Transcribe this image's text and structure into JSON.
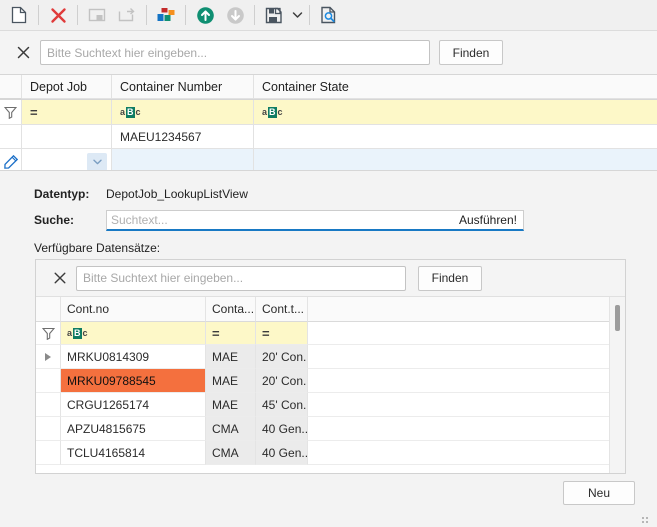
{
  "toolbar": {
    "buttons": [
      {
        "name": "new-document-icon",
        "title": "Neu"
      },
      {
        "name": "delete-icon",
        "title": "Löschen"
      },
      {
        "name": "restore-window-icon",
        "title": "Wiederherstellen"
      },
      {
        "name": "open-external-icon",
        "title": "Öffnen"
      },
      {
        "name": "layout-blocks-icon",
        "title": "Layout"
      },
      {
        "name": "upload-arrow-up-icon",
        "title": "Hochladen"
      },
      {
        "name": "download-arrow-down-icon",
        "title": "Herunterladen"
      },
      {
        "name": "save-icon",
        "title": "Speichern"
      },
      {
        "name": "chevron-down-icon",
        "title": "Mehr"
      },
      {
        "name": "document-search-icon",
        "title": "Suchen"
      }
    ]
  },
  "top_search": {
    "close_label": "✕",
    "placeholder": "Bitte Suchtext hier eingeben...",
    "value": "",
    "find_label": "Finden"
  },
  "main_grid": {
    "columns": [
      "Depot Job",
      "Container Number",
      "Container State"
    ],
    "filter_row": {
      "depot_job": "=",
      "container_number": "aBc",
      "container_state": "aBc"
    },
    "rows": [
      {
        "depot_job": "",
        "container_number": "MAEU1234567",
        "container_state": ""
      }
    ],
    "edit_row": {
      "depot_job": "",
      "container_number": "",
      "container_state": ""
    }
  },
  "detail": {
    "datentyp_label": "Datentyp:",
    "datentyp_value": "DepotJob_LookupListView",
    "suche_label": "Suche:",
    "suche_placeholder": "Suchtext...",
    "suche_value": "",
    "ausfuehren_label": "Ausführen!",
    "verfuegbar_label": "Verfügbare Datensätze:",
    "inner_search": {
      "close_label": "✕",
      "placeholder": "Bitte Suchtext hier eingeben...",
      "value": "",
      "find_label": "Finden"
    },
    "inner_grid": {
      "columns": [
        "Cont.no",
        "Conta...",
        "Cont.t...",
        ""
      ],
      "filter_row": {
        "cont_no": "aBc",
        "conta": "=",
        "cont_t": "="
      },
      "rows": [
        {
          "cont_no": "MRKU0814309",
          "conta": "MAE",
          "cont_t": "20' Con...",
          "expandable": true,
          "selected": false
        },
        {
          "cont_no": "MRKU09788545",
          "conta": "MAE",
          "cont_t": "20' Con...",
          "expandable": false,
          "selected": true
        },
        {
          "cont_no": "CRGU1265174",
          "conta": "MAE",
          "cont_t": "45' Con...",
          "expandable": false,
          "selected": false
        },
        {
          "cont_no": "APZU4815675",
          "conta": "CMA",
          "cont_t": "40 Gen...",
          "expandable": false,
          "selected": false
        },
        {
          "cont_no": "TCLU4165814",
          "conta": "CMA",
          "cont_t": "40 Gen...",
          "expandable": false,
          "selected": false
        }
      ]
    },
    "neu_label": "Neu"
  },
  "colors": {
    "filter_yellow": "#fdf8c8",
    "selection_orange": "#f4703e",
    "accent_blue": "#1879c4",
    "abc_badge_green": "#0f7c63",
    "delete_red": "#e03b3b",
    "upload_green": "#0f8f72"
  }
}
